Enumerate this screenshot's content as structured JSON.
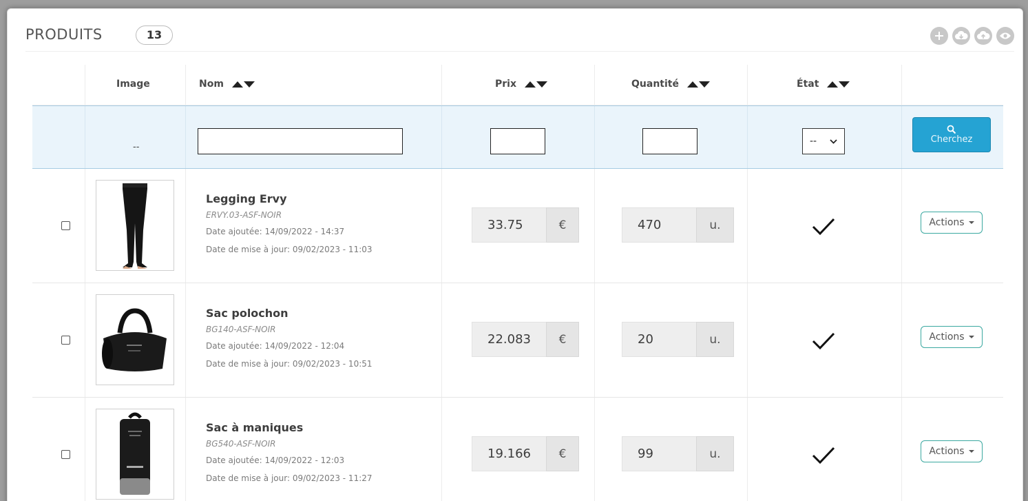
{
  "header": {
    "title": "PRODUITS",
    "count": "13",
    "tools": [
      {
        "icon": "add-icon"
      },
      {
        "icon": "cloud-download-icon"
      },
      {
        "icon": "cloud-upload-icon"
      },
      {
        "icon": "eye-icon"
      }
    ]
  },
  "table": {
    "columns": {
      "image": "Image",
      "name": "Nom",
      "price": "Prix",
      "quantity": "Quantité",
      "status": "État"
    },
    "filters": {
      "image_placeholder": "--",
      "name_value": "",
      "price_value": "",
      "quantity_value": "",
      "status_selected": "--",
      "search_label": "Cherchez"
    },
    "rows": [
      {
        "name": "Legging Ervy",
        "reference": "ERVY.03-ASF-NOIR",
        "date_added": "Date ajoutée: 14/09/2022 - 14:37",
        "date_updated": "Date de mise à jour: 09/02/2023 - 11:03",
        "price": "33.75",
        "currency": "€",
        "quantity": "470",
        "unit": "u.",
        "active": true,
        "actions_label": "Actions",
        "thumb_icon": "legging-product-image"
      },
      {
        "name": "Sac polochon",
        "reference": "BG140-ASF-NOIR",
        "date_added": "Date ajoutée: 14/09/2022 - 12:04",
        "date_updated": "Date de mise à jour: 09/02/2023 - 10:51",
        "price": "22.083",
        "currency": "€",
        "quantity": "20",
        "unit": "u.",
        "active": true,
        "actions_label": "Actions",
        "thumb_icon": "duffel-bag-product-image"
      },
      {
        "name": "Sac à maniques",
        "reference": "BG540-ASF-NOIR",
        "date_added": "Date ajoutée: 14/09/2022 - 12:03",
        "date_updated": "Date de mise à jour: 09/02/2023 - 11:27",
        "price": "19.166",
        "currency": "€",
        "quantity": "99",
        "unit": "u.",
        "active": true,
        "actions_label": "Actions",
        "thumb_icon": "grip-bag-product-image"
      }
    ]
  },
  "colors": {
    "search_button": "#25a3d3",
    "filter_row_bg": "#eaf4fb",
    "actions_border": "#3aa8a0"
  }
}
